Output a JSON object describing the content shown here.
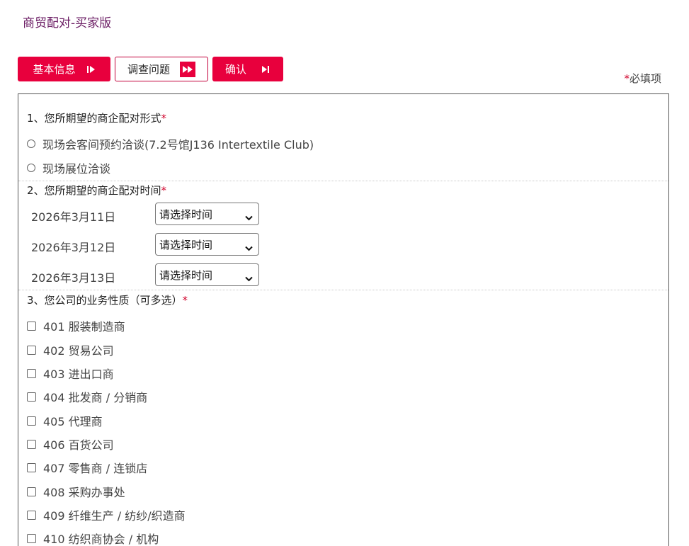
{
  "page_title": "商贸配对-买家版",
  "tabs": [
    {
      "label": "基本信息",
      "icon": "step-forward-icon"
    },
    {
      "label": "调查问题",
      "icon": "fast-forward-icon"
    },
    {
      "label": "确认",
      "icon": "skip-end-icon"
    }
  ],
  "required_star": "*",
  "required_label": "必填项",
  "q1": {
    "title": "1、您所期望的商企配对形式",
    "options": [
      "现场会客间预约洽谈(7.2号馆J136 Intertextile Club)",
      "现场展位洽谈"
    ]
  },
  "q2": {
    "title": "2、您所期望的商企配对时间",
    "dates": [
      {
        "date": "2026年3月11日",
        "select": "请选择时间"
      },
      {
        "date": "2026年3月12日",
        "select": "请选择时间"
      },
      {
        "date": "2026年3月13日",
        "select": "请选择时间"
      }
    ]
  },
  "q3": {
    "title": "3、您公司的业务性质（可多选）",
    "options": [
      "401 服装制造商",
      "402 贸易公司",
      "403 进出口商",
      "404 批发商 / 分销商",
      "405 代理商",
      "406 百货公司",
      "407 零售商 / 连锁店",
      "408 采购办事处",
      "409 纤维生产 / 纺纱/织造商",
      "410 纺织商协会 / 机构"
    ]
  },
  "colors": {
    "accent": "#e8003d",
    "title": "#6a1b63",
    "required": "#d0002a"
  }
}
